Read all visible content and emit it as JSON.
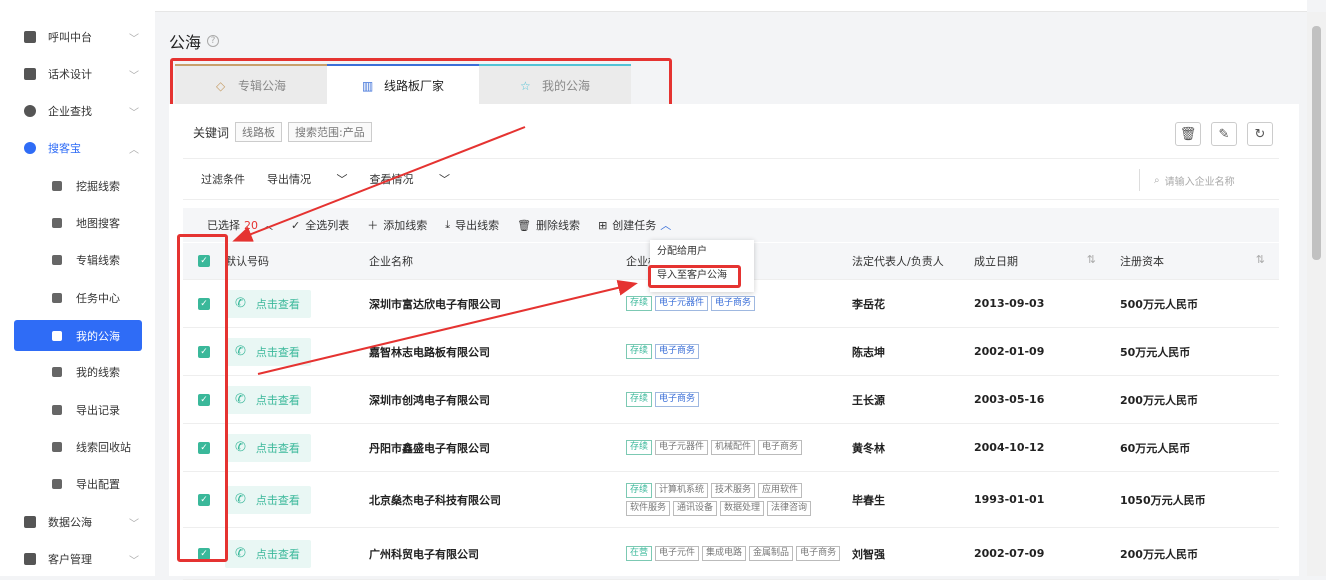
{
  "sidebar": {
    "items": [
      {
        "label": "呼叫中台",
        "icon": "monitor-icon"
      },
      {
        "label": "话术设计",
        "icon": "script-icon"
      },
      {
        "label": "企业查找",
        "icon": "bulb-icon"
      },
      {
        "label": "搜客宝",
        "icon": "search-icon"
      },
      {
        "label": "数据公海",
        "icon": "monitor-icon"
      },
      {
        "label": "客户管理",
        "icon": "customer-icon"
      }
    ],
    "sub_items": [
      {
        "label": "挖掘线索"
      },
      {
        "label": "地图搜客"
      },
      {
        "label": "专辑线索"
      },
      {
        "label": "任务中心"
      },
      {
        "label": "我的公海"
      },
      {
        "label": "我的线索"
      },
      {
        "label": "导出记录"
      },
      {
        "label": "线索回收站"
      },
      {
        "label": "导出配置"
      }
    ]
  },
  "page_title": "公海",
  "tabs": [
    {
      "label": "专辑公海"
    },
    {
      "label": "线路板厂家"
    },
    {
      "label": "我的公海"
    }
  ],
  "keyword": {
    "label": "关键词",
    "tags": [
      "线路板",
      "搜索范围:产品"
    ]
  },
  "filter": {
    "conditions": "过滤条件",
    "export_status": "导出情况",
    "view_status": "查看情况",
    "search_placeholder": "请输入企业名称"
  },
  "actions": {
    "selected_prefix": "已选择",
    "selected_count": "20",
    "select_all": "全选列表",
    "add_lead": "添加线索",
    "export_lead": "导出线索",
    "delete_lead": "删除线索",
    "create_task": "创建任务"
  },
  "dropdown": [
    "分配给用户",
    "导入至客户公海"
  ],
  "table": {
    "headers": [
      "默认号码",
      "企业名称",
      "企业标签",
      "法定代表人/负责人",
      "成立日期",
      "注册资本"
    ],
    "call_label": "点击查看",
    "rows": [
      {
        "company": "深圳市富达欣电子有限公司",
        "tags": [
          "存续",
          "电子元器件",
          "电子商务"
        ],
        "rep": "李岳花",
        "date": "2013-09-03",
        "capital": "500万元人民币"
      },
      {
        "company": "嘉智林志电路板有限公司",
        "tags": [
          "存续",
          "电子商务"
        ],
        "rep": "陈志坤",
        "date": "2002-01-09",
        "capital": "50万元人民币"
      },
      {
        "company": "深圳市创鸿电子有限公司",
        "tags": [
          "存续",
          "电子商务"
        ],
        "rep": "王长源",
        "date": "2003-05-16",
        "capital": "200万元人民币"
      },
      {
        "company": "丹阳市鑫盛电子有限公司",
        "tags": [
          "存续",
          "电子元器件",
          "机械配件",
          "电子商务"
        ],
        "rep": "黄冬林",
        "date": "2004-10-12",
        "capital": "60万元人民币"
      },
      {
        "company": "北京燊杰电子科技有限公司",
        "tags": [
          "存续",
          "计算机系统",
          "技术服务",
          "应用软件",
          "软件服务",
          "通讯设备",
          "数据处理",
          "法律咨询"
        ],
        "rep": "毕春生",
        "date": "1993-01-01",
        "capital": "1050万元人民币"
      },
      {
        "company": "广州科贸电子有限公司",
        "tags": [
          "在营",
          "电子元件",
          "集成电路",
          "金属制品",
          "电子商务"
        ],
        "rep": "刘智强",
        "date": "2002-07-09",
        "capital": "200万元人民币"
      }
    ]
  },
  "colors": {
    "accent": "#2f6cf6",
    "highlight": "#e53331",
    "green": "#3ab89a"
  }
}
